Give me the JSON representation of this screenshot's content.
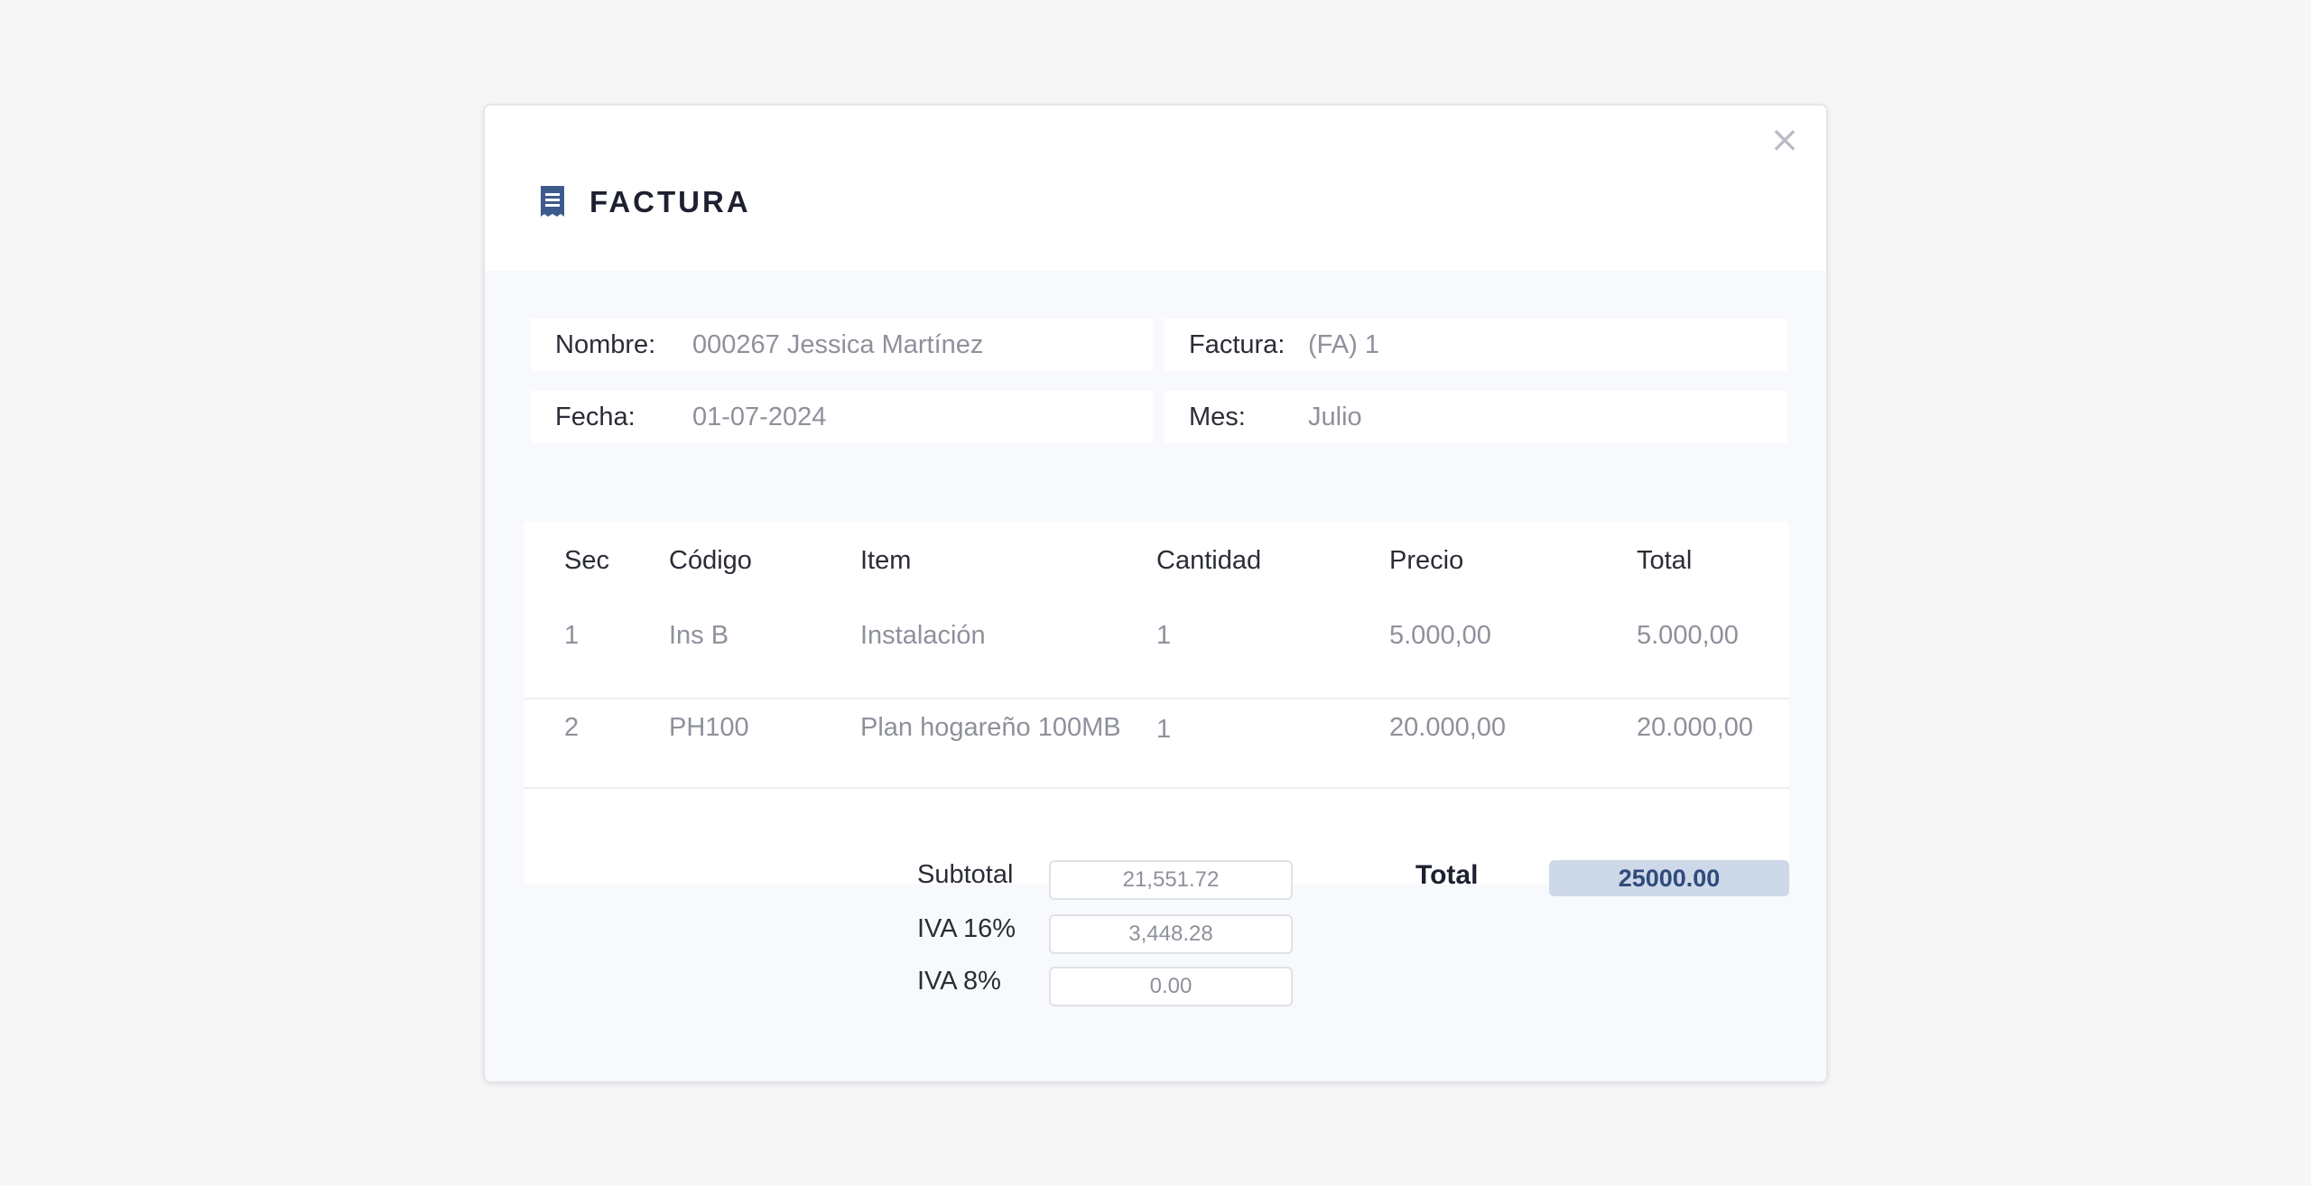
{
  "modal": {
    "title": "FACTURA",
    "close_glyph": "×",
    "icon": "receipt-icon"
  },
  "info": {
    "nombre_label": "Nombre:",
    "nombre_value": "000267 Jessica Martínez",
    "factura_label": "Factura:",
    "factura_value": "(FA) 1",
    "fecha_label": "Fecha:",
    "fecha_value": "01-07-2024",
    "mes_label": "Mes:",
    "mes_value": "Julio"
  },
  "table": {
    "headers": [
      "Sec",
      "Código",
      "Item",
      "Cantidad",
      "Precio",
      "Total"
    ],
    "rows": [
      [
        "1",
        "Ins B",
        "Instalación",
        "1",
        "5.000,00",
        "5.000,00"
      ],
      [
        "2",
        "PH100",
        "Plan hogareño 100MB",
        "1",
        "20.000,00",
        "20.000,00"
      ]
    ]
  },
  "totals": {
    "subtotal_label": "Subtotal",
    "subtotal_value": "21,551.72",
    "iva16_label": "IVA 16%",
    "iva16_value": "3,448.28",
    "iva8_label": "IVA 8%",
    "iva8_value": "0.00",
    "total_label": "Total",
    "total_value": "25000.00"
  },
  "colors": {
    "accent": "#2f4b7c",
    "total_bg": "#cdd8e8"
  }
}
